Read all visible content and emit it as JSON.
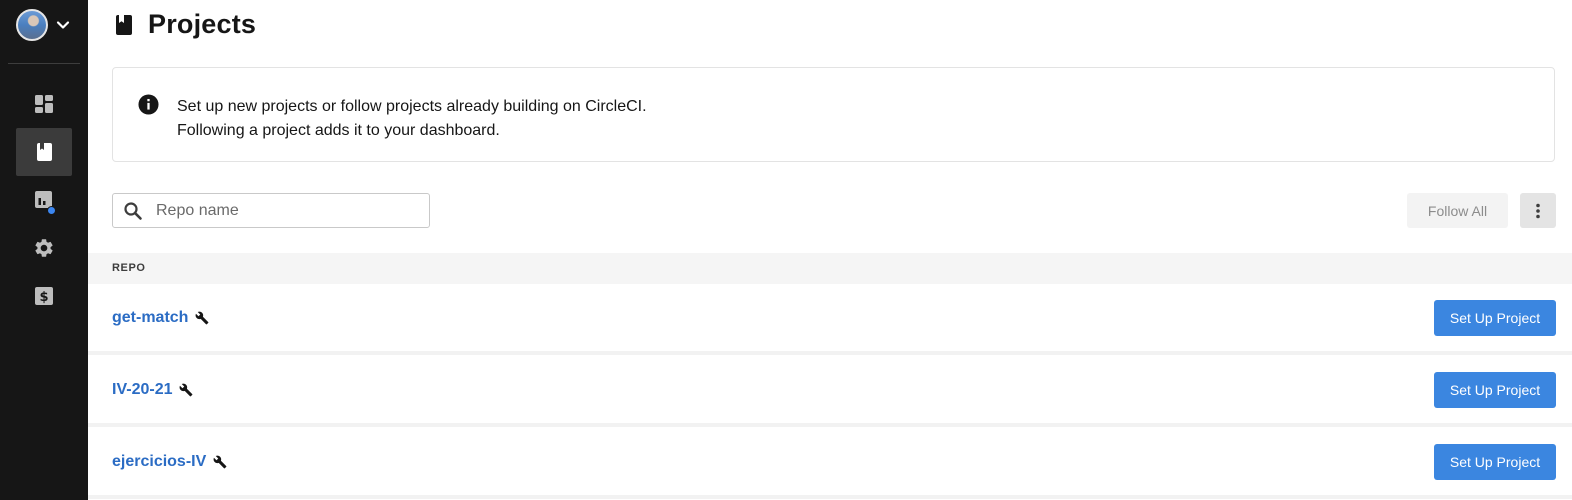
{
  "sidebar": {
    "account": {
      "avatar": "avatar",
      "dropdown_icon": "chevron-down-icon"
    },
    "items": [
      {
        "id": "dashboard",
        "icon": "dashboard-icon",
        "active": false
      },
      {
        "id": "projects",
        "icon": "book-icon",
        "active": true
      },
      {
        "id": "insights",
        "icon": "insights-icon",
        "active": false,
        "has_notification": true
      },
      {
        "id": "settings",
        "icon": "gear-icon",
        "active": false
      },
      {
        "id": "plan",
        "icon": "dollar-icon",
        "active": false
      }
    ]
  },
  "header": {
    "title": "Projects",
    "icon": "book-icon"
  },
  "info": {
    "icon": "info-icon",
    "line1": "Set up new projects or follow projects already building on CircleCI.",
    "line2": "Following a project adds it to your dashboard."
  },
  "search": {
    "placeholder": "Repo name",
    "value": ""
  },
  "toolbar": {
    "follow_all_label": "Follow All",
    "more_icon": "more-vertical-icon"
  },
  "table": {
    "header": "REPO",
    "rows": [
      {
        "name": "get-match",
        "icon": "wrench-icon",
        "action": "Set Up Project"
      },
      {
        "name": "IV-20-21",
        "icon": "wrench-icon",
        "action": "Set Up Project"
      },
      {
        "name": "ejercicios-IV",
        "icon": "wrench-icon",
        "action": "Set Up Project"
      }
    ]
  },
  "colors": {
    "sidebar_bg": "#161616",
    "accent_link": "#2b6cc4",
    "primary_button": "#3b86e0",
    "notification_dot": "#3b86f0"
  }
}
